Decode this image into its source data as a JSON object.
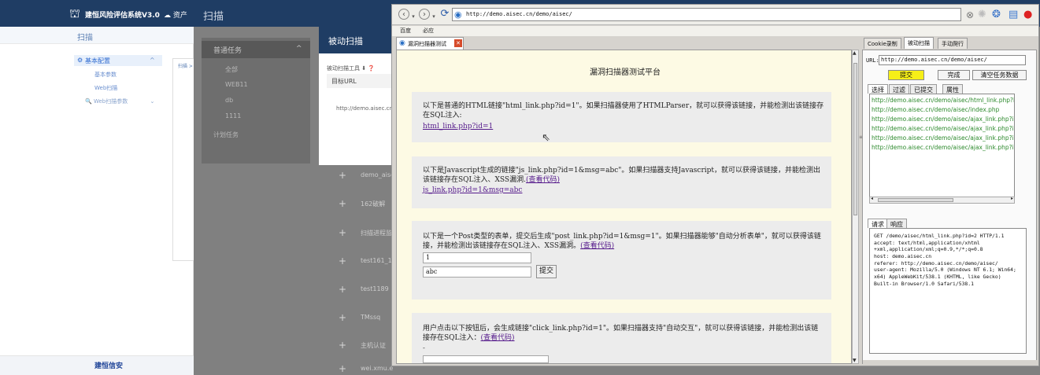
{
  "app": {
    "title": "建恒风险评估系统V3.0",
    "asset_link": "资产",
    "top_scan": "扫描",
    "sidebar_header": "扫描",
    "menu_basic_config": "基本配置",
    "menu_basic_params": "基本参数",
    "menu_web_scan": "Web扫描",
    "menu_web_scan_params": "Web扫描参数",
    "side_col_label": "扫描 >",
    "footer_logo": "建恒信安"
  },
  "task_panel": {
    "header": "普通任务",
    "items": [
      "全部",
      "WEB11",
      "db",
      "1111"
    ],
    "scheduled": "计划任务"
  },
  "modal": {
    "title": "被动扫描",
    "tool_label": "被动扫描工具",
    "col_target_url": "目标URL",
    "row_url": "http://demo.aisec.cn/"
  },
  "task_rows": [
    "demo_aise",
    "162破解",
    "扫描进程监",
    "test161_1",
    "test1189",
    "TMssq",
    "主机认证",
    "wei.xmu.e"
  ],
  "browser": {
    "address": "http://demo.aisec.cn/demo/aisec/",
    "bookmarks": [
      "百度",
      "必应"
    ],
    "tab_title": "漏洞扫描器测试",
    "right_tabs": [
      "Cookie录制",
      "被动扫描",
      "手动爬行"
    ]
  },
  "page": {
    "title": "漏洞扫描器测试平台",
    "sections": [
      {
        "text": "以下是普通的HTML链接\"html_link.php?id=1\"。如果扫描器使用了HTMLParser，就可以获得该链接，并能检测出该链接存在SQL注入:",
        "link": "html_link.php?id=1"
      },
      {
        "text": "以下是Javascript生成的链接\"js_link.php?id=1&msg=abc\"。如果扫描器支持Javascript，就可以获得该链接，并能检测出该链接存在SQL注入、XSS漏洞.",
        "code_link": "(查看代码)",
        "link": "js_link.php?id=1&msg=abc"
      },
      {
        "text": "以下是一个Post类型的表单，提交后生成\"post_link.php?id=1&msg=1\"。如果扫描器能够\"自动分析表单\"，就可以获得该链接，并能检测出该链接存在SQL注入、XSS漏洞。",
        "code_link": "(查看代码)",
        "input1": "1",
        "input2": "abc",
        "submit": "提交"
      },
      {
        "text": "用户点击以下按钮后，会生成链接\"click_link.php?id=1\"。如果扫描器支持\"自动交互\"，就可以获得该链接，并能检测出该链接存在SQL注入：",
        "code_link": "(查看代码)",
        "dash": "-"
      }
    ]
  },
  "panel": {
    "url_label": "URL:",
    "url_value": "http://demo.aisec.cn/demo/aisec/",
    "btn_submit": "提交",
    "btn_done": "完成",
    "btn_clear": "清空任务数据",
    "subtabs": [
      "选择",
      "过滤",
      "已提交",
      "属性"
    ],
    "urls": [
      "http://demo.aisec.cn/demo/aisec/html_link.php?id",
      "http://demo.aisec.cn/demo/aisec/index.php",
      "http://demo.aisec.cn/demo/aisec/ajax_link.php?id=",
      "http://demo.aisec.cn/demo/aisec/ajax_link.php?id=",
      "http://demo.aisec.cn/demo/aisec/ajax_link.php?id=",
      "http://demo.aisec.cn/demo/aisec/ajax_link.php?id="
    ],
    "req_tabs": [
      "请求",
      "响应"
    ],
    "request_lines": [
      "GET /demo/aisec/html_link.php?id=2 HTTP/1.1",
      "accept: text/html,application/xhtml",
      "+xml,application/xml;q=0.9,*/*;q=0.8",
      "host: demo.aisec.cn",
      "referer: http://demo.aisec.cn/demo/aisec/",
      "user-agent: Mozilla/5.0 (Windows NT 6.1; Win64;",
      "x64) AppleWebKit/538.1 (KHTML, like Gecko)",
      "Built-in Browser/1.0 Safari/538.1"
    ]
  }
}
